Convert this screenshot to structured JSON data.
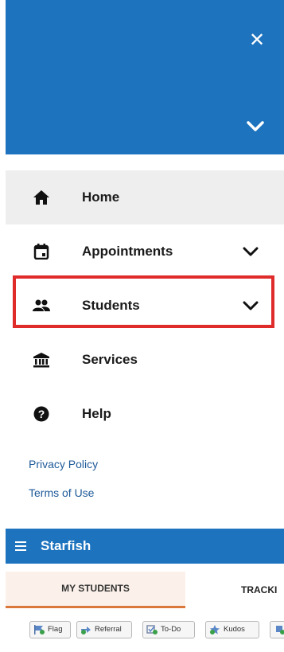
{
  "header": {
    "close_icon": "close-icon",
    "collapse_icon": "chevron-down-icon",
    "background": "#1e73be"
  },
  "nav": {
    "items": [
      {
        "label": "Home",
        "icon": "home-icon",
        "active": true
      },
      {
        "label": "Appointments",
        "icon": "calendar-icon",
        "expandable": true
      },
      {
        "label": "Students",
        "icon": "people-icon",
        "expandable": true,
        "highlighted": true
      },
      {
        "label": "Services",
        "icon": "bank-icon"
      },
      {
        "label": "Help",
        "icon": "help-icon"
      }
    ]
  },
  "links": {
    "privacy": "Privacy Policy",
    "terms": "Terms of Use"
  },
  "app_bar": {
    "title": "Starfish",
    "menu_icon": "hamburger-icon"
  },
  "tabs": {
    "my_students": "MY STUDENTS",
    "tracking": "TRACKI"
  },
  "toolbar": {
    "buttons": [
      "Flag",
      "Referral",
      "To-Do",
      "Kudos"
    ]
  },
  "colors": {
    "accent": "#1e73be",
    "highlight": "#e02b2b",
    "tab_underline": "#d9783a",
    "link": "#1e5a99"
  }
}
